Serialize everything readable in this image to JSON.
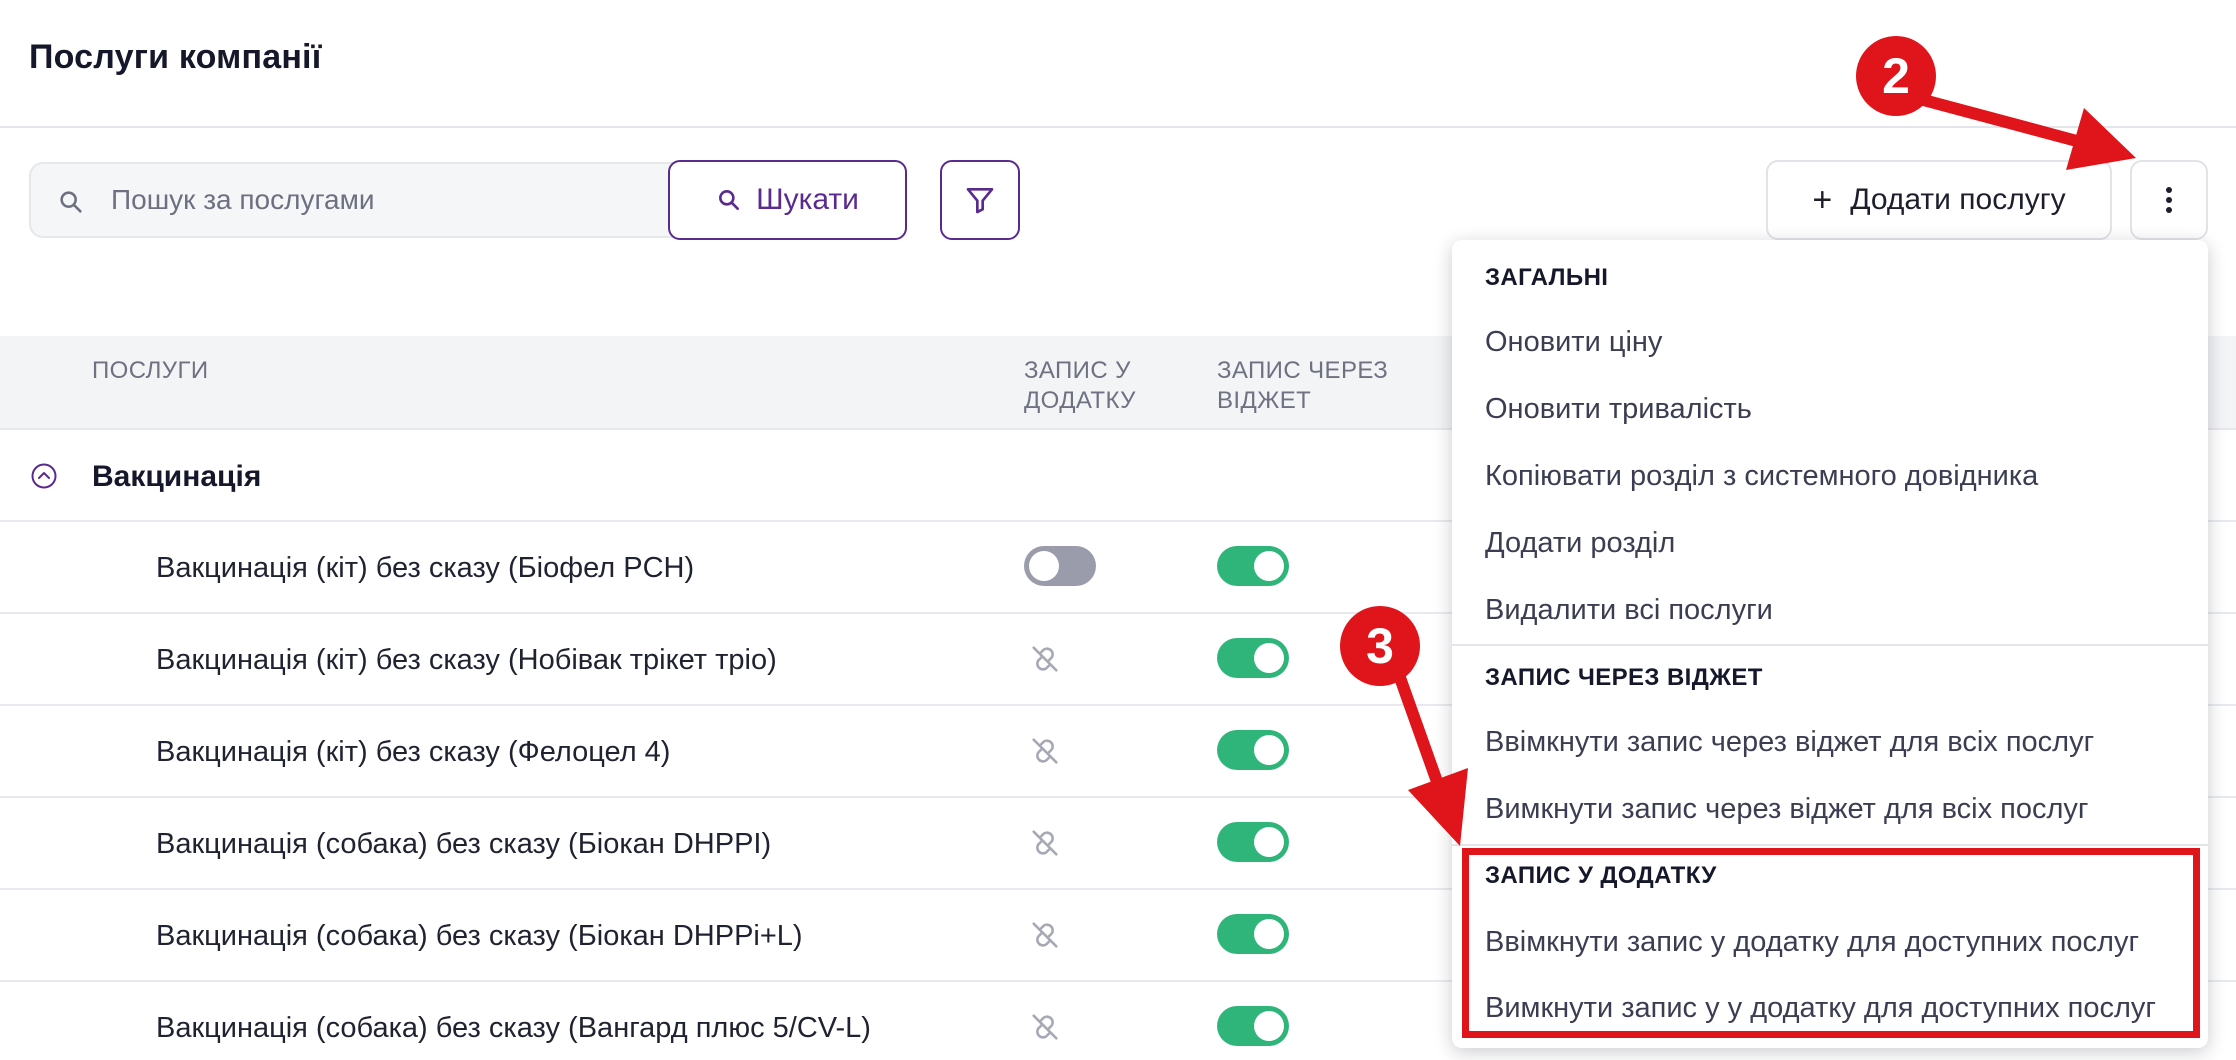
{
  "header": {
    "title": "Послуги компанії"
  },
  "toolbar": {
    "search_placeholder": "Пошук за послугами",
    "search_button_label": "Шукати",
    "add_service_label": "Додати послугу"
  },
  "table": {
    "columns": {
      "services": "ПОСЛУГИ",
      "app_booking": "ЗАПИС У ДОДАТКУ",
      "widget_booking": "ЗАПИС ЧЕРЕЗ ВІДЖЕТ"
    },
    "group": {
      "name": "Вакцинація",
      "icon": "chevron-up-circle-icon"
    },
    "rows": [
      {
        "name": "Вакцинація (кіт) без сказу (Біофел PCH)",
        "app": "toggle-off",
        "widget": "toggle-on"
      },
      {
        "name": "Вакцинація (кіт) без сказу (Нобівак трікет тріо)",
        "app": "unlinked",
        "widget": "toggle-on"
      },
      {
        "name": "Вакцинація (кіт) без сказу (Фелоцел 4)",
        "app": "unlinked",
        "widget": "toggle-on"
      },
      {
        "name": "Вакцинація (собака) без сказу (Біокан DHPPI)",
        "app": "unlinked",
        "widget": "toggle-on"
      },
      {
        "name": "Вакцинація (собака) без сказу (Біокан DHPPi+L)",
        "app": "unlinked",
        "widget": "toggle-on"
      },
      {
        "name": "Вакцинація (собака) без сказу (Вангард плюс 5/CV-L)",
        "app": "unlinked",
        "widget": "toggle-on"
      }
    ]
  },
  "dropdown": {
    "sections": [
      {
        "heading": "ЗАГАЛЬНІ",
        "items": [
          "Оновити ціну",
          "Оновити тривалість",
          "Копіювати розділ з системного довідника",
          "Додати розділ",
          "Видалити всі послуги"
        ]
      },
      {
        "heading": "ЗАПИС ЧЕРЕЗ ВІДЖЕТ",
        "items": [
          "Ввімкнути запис через віджет для всіх послуг",
          "Вимкнути запис через віджет для всіх послуг"
        ]
      },
      {
        "heading": "ЗАПИС У ДОДАТКУ",
        "items": [
          "Ввімкнути запис у додатку для доступних послуг",
          "Вимкнути запис у у додатку для доступних послуг"
        ]
      }
    ]
  },
  "annotations": {
    "badge_2": "2",
    "badge_3": "3",
    "color": "#e0141b"
  },
  "colors": {
    "accent": "#5b2a8e",
    "toggle_on": "#2fb57a",
    "toggle_off": "#9a9cab"
  },
  "icons": [
    "search-icon",
    "filter-icon",
    "plus-icon",
    "more-vertical-icon",
    "chevron-up-circle-icon",
    "unlink-icon"
  ]
}
